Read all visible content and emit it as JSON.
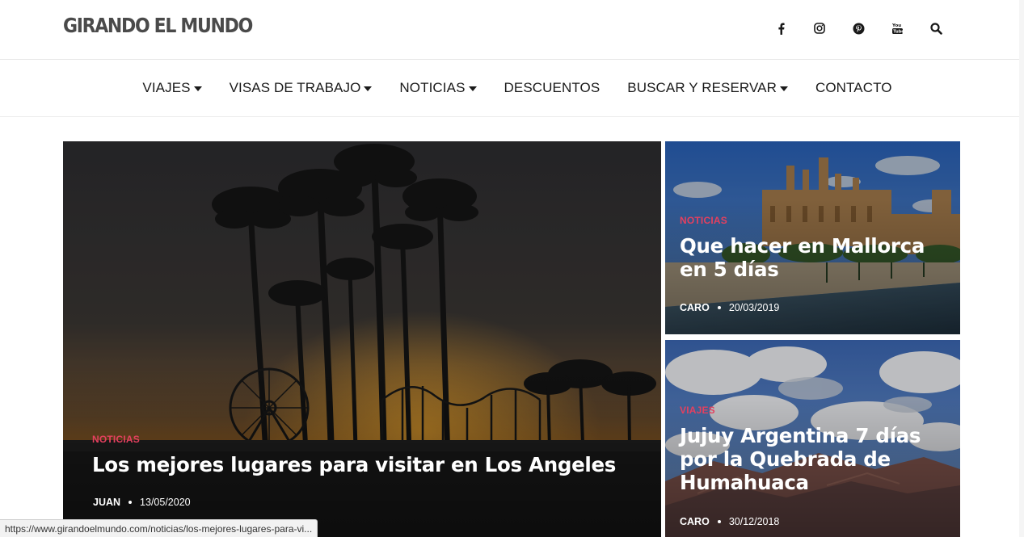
{
  "brand": {
    "logo_text": "GIRANDO EL MUNDO"
  },
  "social_icons": [
    "facebook-icon",
    "instagram-icon",
    "pinterest-icon",
    "youtube-icon",
    "search-icon"
  ],
  "nav": {
    "items": [
      {
        "label": "VIAJES",
        "has_dropdown": true
      },
      {
        "label": "VISAS DE TRABAJO",
        "has_dropdown": true
      },
      {
        "label": "NOTICIAS",
        "has_dropdown": true
      },
      {
        "label": "DESCUENTOS",
        "has_dropdown": false
      },
      {
        "label": "BUSCAR Y RESERVAR",
        "has_dropdown": true
      },
      {
        "label": "CONTACTO",
        "has_dropdown": false
      }
    ]
  },
  "featured": {
    "main": {
      "category": "NOTICIAS",
      "title": "Los mejores lugares para visitar en Los Angeles",
      "author": "JUAN",
      "date": "13/05/2020"
    },
    "side_top": {
      "category": "NOTICIAS",
      "title": "Que hacer en Mallorca en 5 días",
      "author": "CARO",
      "date": "20/03/2019"
    },
    "side_bottom": {
      "category": "VIAJES",
      "title": "Jujuy Argentina 7 días por la Quebrada de Humahuaca",
      "author": "CARO",
      "date": "30/12/2018"
    }
  },
  "colors": {
    "accent": "#e4405f",
    "text": "#1a1a1a",
    "logo": "#4a4a4a"
  },
  "status_bar": {
    "url": "https://www.girandoelmundo.com/noticias/los-mejores-lugares-para-vi..."
  }
}
